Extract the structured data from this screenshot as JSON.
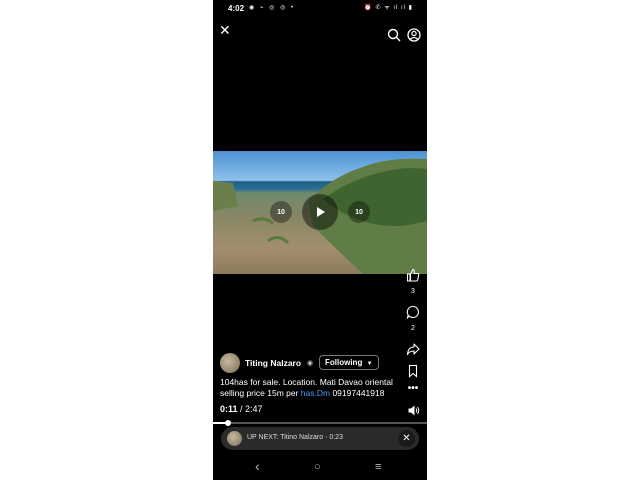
{
  "status_bar": {
    "time": "4:02",
    "left_icons": "◉ ⌁ ◎ ◎ •",
    "right_icons": "⏰ ✆ ᯤ ıl ıl ▮"
  },
  "top_bar": {
    "close_glyph": "✕"
  },
  "video": {
    "rewind_label": "10",
    "forward_label": "10",
    "progress_fraction": 0.07
  },
  "actions": {
    "like_count": "3",
    "comment_count": "2"
  },
  "post": {
    "author": "Titing Nalzaro",
    "follow_label": "Following",
    "caption_text": "104has for sale. Location. Mati Davao oriental selling price 15m per ",
    "caption_link": "has.Dm",
    "caption_tail": " 09197441918"
  },
  "playback": {
    "current": "0:11",
    "separator": " / ",
    "duration": "2:47"
  },
  "up_next": {
    "label": "UP NEXT: Titino Nalzaro · 0:23",
    "close_glyph": "✕"
  },
  "nav": {
    "back": "‹",
    "home": "○",
    "recents": "≡"
  }
}
